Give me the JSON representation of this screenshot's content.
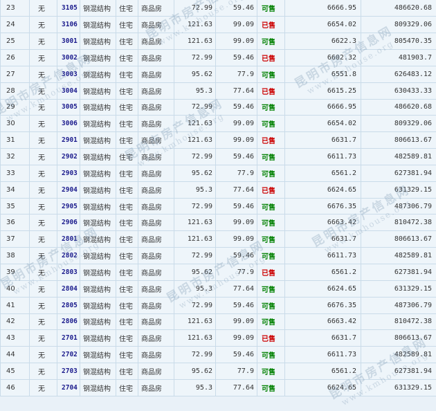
{
  "rows": [
    {
      "idx": "23",
      "indicator": "无",
      "room": "3105",
      "structure": "钢混结构",
      "usage": "住宅",
      "house_type": "商品房",
      "built_area": "72.99",
      "inner_area": "59.46",
      "status": "可售",
      "unit_price": "6666.95",
      "total_price": "486620.68"
    },
    {
      "idx": "24",
      "indicator": "无",
      "room": "3106",
      "structure": "钢混结构",
      "usage": "住宅",
      "house_type": "商品房",
      "built_area": "121.63",
      "inner_area": "99.09",
      "status": "已售",
      "unit_price": "6654.02",
      "total_price": "809329.06"
    },
    {
      "idx": "25",
      "indicator": "无",
      "room": "3001",
      "structure": "钢混结构",
      "usage": "住宅",
      "house_type": "商品房",
      "built_area": "121.63",
      "inner_area": "99.09",
      "status": "可售",
      "unit_price": "6622.3",
      "total_price": "805470.35"
    },
    {
      "idx": "26",
      "indicator": "无",
      "room": "3002",
      "structure": "钢混结构",
      "usage": "住宅",
      "house_type": "商品房",
      "built_area": "72.99",
      "inner_area": "59.46",
      "status": "已售",
      "unit_price": "6602.32",
      "total_price": "481903.7"
    },
    {
      "idx": "27",
      "indicator": "无",
      "room": "3003",
      "structure": "钢混结构",
      "usage": "住宅",
      "house_type": "商品房",
      "built_area": "95.62",
      "inner_area": "77.9",
      "status": "可售",
      "unit_price": "6551.8",
      "total_price": "626483.12"
    },
    {
      "idx": "28",
      "indicator": "无",
      "room": "3004",
      "structure": "钢混结构",
      "usage": "住宅",
      "house_type": "商品房",
      "built_area": "95.3",
      "inner_area": "77.64",
      "status": "已售",
      "unit_price": "6615.25",
      "total_price": "630433.33"
    },
    {
      "idx": "29",
      "indicator": "无",
      "room": "3005",
      "structure": "钢混结构",
      "usage": "住宅",
      "house_type": "商品房",
      "built_area": "72.99",
      "inner_area": "59.46",
      "status": "可售",
      "unit_price": "6666.95",
      "total_price": "486620.68"
    },
    {
      "idx": "30",
      "indicator": "无",
      "room": "3006",
      "structure": "钢混结构",
      "usage": "住宅",
      "house_type": "商品房",
      "built_area": "121.63",
      "inner_area": "99.09",
      "status": "可售",
      "unit_price": "6654.02",
      "total_price": "809329.06"
    },
    {
      "idx": "31",
      "indicator": "无",
      "room": "2901",
      "structure": "钢混结构",
      "usage": "住宅",
      "house_type": "商品房",
      "built_area": "121.63",
      "inner_area": "99.09",
      "status": "已售",
      "unit_price": "6631.7",
      "total_price": "806613.67"
    },
    {
      "idx": "32",
      "indicator": "无",
      "room": "2902",
      "structure": "钢混结构",
      "usage": "住宅",
      "house_type": "商品房",
      "built_area": "72.99",
      "inner_area": "59.46",
      "status": "可售",
      "unit_price": "6611.73",
      "total_price": "482589.81"
    },
    {
      "idx": "33",
      "indicator": "无",
      "room": "2903",
      "structure": "钢混结构",
      "usage": "住宅",
      "house_type": "商品房",
      "built_area": "95.62",
      "inner_area": "77.9",
      "status": "可售",
      "unit_price": "6561.2",
      "total_price": "627381.94"
    },
    {
      "idx": "34",
      "indicator": "无",
      "room": "2904",
      "structure": "钢混结构",
      "usage": "住宅",
      "house_type": "商品房",
      "built_area": "95.3",
      "inner_area": "77.64",
      "status": "已售",
      "unit_price": "6624.65",
      "total_price": "631329.15"
    },
    {
      "idx": "35",
      "indicator": "无",
      "room": "2905",
      "structure": "钢混结构",
      "usage": "住宅",
      "house_type": "商品房",
      "built_area": "72.99",
      "inner_area": "59.46",
      "status": "可售",
      "unit_price": "6676.35",
      "total_price": "487306.79"
    },
    {
      "idx": "36",
      "indicator": "无",
      "room": "2906",
      "structure": "钢混结构",
      "usage": "住宅",
      "house_type": "商品房",
      "built_area": "121.63",
      "inner_area": "99.09",
      "status": "可售",
      "unit_price": "6663.42",
      "total_price": "810472.38"
    },
    {
      "idx": "37",
      "indicator": "无",
      "room": "2801",
      "structure": "钢混结构",
      "usage": "住宅",
      "house_type": "商品房",
      "built_area": "121.63",
      "inner_area": "99.09",
      "status": "可售",
      "unit_price": "6631.7",
      "total_price": "806613.67"
    },
    {
      "idx": "38",
      "indicator": "无",
      "room": "2802",
      "structure": "钢混结构",
      "usage": "住宅",
      "house_type": "商品房",
      "built_area": "72.99",
      "inner_area": "59.46",
      "status": "可售",
      "unit_price": "6611.73",
      "total_price": "482589.81"
    },
    {
      "idx": "39",
      "indicator": "无",
      "room": "2803",
      "structure": "钢混结构",
      "usage": "住宅",
      "house_type": "商品房",
      "built_area": "95.62",
      "inner_area": "77.9",
      "status": "已售",
      "unit_price": "6561.2",
      "total_price": "627381.94"
    },
    {
      "idx": "40",
      "indicator": "无",
      "room": "2804",
      "structure": "钢混结构",
      "usage": "住宅",
      "house_type": "商品房",
      "built_area": "95.3",
      "inner_area": "77.64",
      "status": "可售",
      "unit_price": "6624.65",
      "total_price": "631329.15"
    },
    {
      "idx": "41",
      "indicator": "无",
      "room": "2805",
      "structure": "钢混结构",
      "usage": "住宅",
      "house_type": "商品房",
      "built_area": "72.99",
      "inner_area": "59.46",
      "status": "可售",
      "unit_price": "6676.35",
      "total_price": "487306.79"
    },
    {
      "idx": "42",
      "indicator": "无",
      "room": "2806",
      "structure": "钢混结构",
      "usage": "住宅",
      "house_type": "商品房",
      "built_area": "121.63",
      "inner_area": "99.09",
      "status": "可售",
      "unit_price": "6663.42",
      "total_price": "810472.38"
    },
    {
      "idx": "43",
      "indicator": "无",
      "room": "2701",
      "structure": "钢混结构",
      "usage": "住宅",
      "house_type": "商品房",
      "built_area": "121.63",
      "inner_area": "99.09",
      "status": "已售",
      "unit_price": "6631.7",
      "total_price": "806613.67"
    },
    {
      "idx": "44",
      "indicator": "无",
      "room": "2702",
      "structure": "钢混结构",
      "usage": "住宅",
      "house_type": "商品房",
      "built_area": "72.99",
      "inner_area": "59.46",
      "status": "可售",
      "unit_price": "6611.73",
      "total_price": "482589.81"
    },
    {
      "idx": "45",
      "indicator": "无",
      "room": "2703",
      "structure": "钢混结构",
      "usage": "住宅",
      "house_type": "商品房",
      "built_area": "95.62",
      "inner_area": "77.9",
      "status": "可售",
      "unit_price": "6561.2",
      "total_price": "627381.94"
    },
    {
      "idx": "46",
      "indicator": "无",
      "room": "2704",
      "structure": "钢混结构",
      "usage": "住宅",
      "house_type": "商品房",
      "built_area": "95.3",
      "inner_area": "77.64",
      "status": "可售",
      "unit_price": "6624.65",
      "total_price": "631329.15"
    }
  ],
  "status_colors": {
    "可售": "#008000",
    "已售": "#cc0000"
  },
  "colors": {
    "room_link": "#1a1a8c",
    "grid_line": "#c9dbe9",
    "background": "#eef5fa"
  },
  "watermark": {
    "cn": "昆明市房产信息网",
    "en": "www.kmhouse.org"
  }
}
